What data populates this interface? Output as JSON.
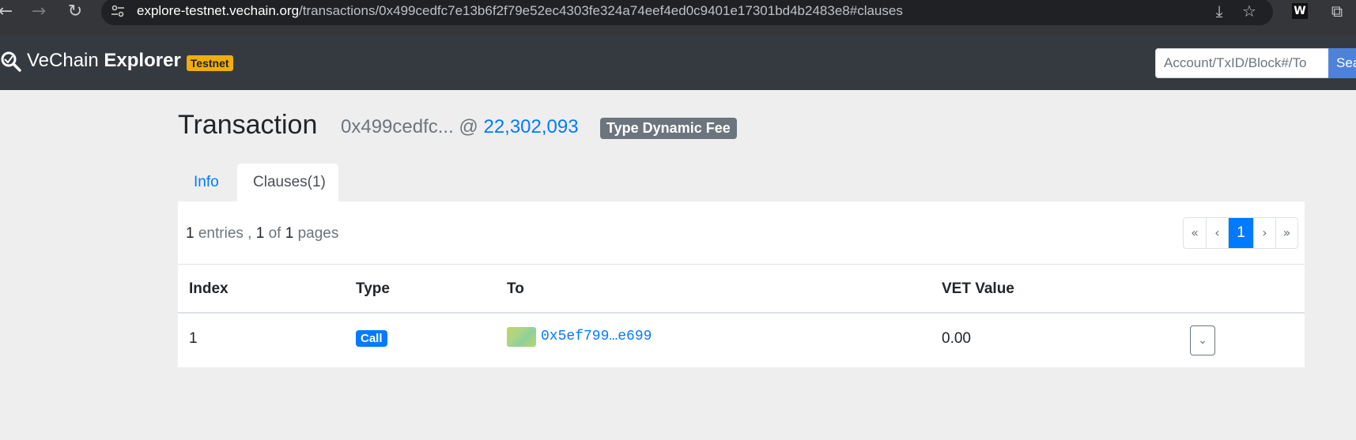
{
  "browser": {
    "url_host": "explore-testnet.vechain.org",
    "url_path": "/transactions/0x499cedfc7e13b6f2f79e52ec4303fe324a74eef4ed0c9401e17301bd4b2483e8#clauses",
    "back_icon": "arrow-left-icon",
    "forward_icon": "arrow-right-icon",
    "reload_icon": "reload-icon",
    "ext_w_label": "W"
  },
  "navbar": {
    "brand_light": "VeChain ",
    "brand_bold": "Explorer",
    "network_badge": "Testnet",
    "search_placeholder": "Account/TxID/Block#/To",
    "search_button": "Sea"
  },
  "header": {
    "title": "Transaction",
    "tx_short": "0x499cedfc...",
    "at": " @ ",
    "block_number": "22,302,093",
    "type_badge": "Type Dynamic Fee"
  },
  "tabs": [
    {
      "label": "Info",
      "active": false
    },
    {
      "label": "Clauses(1)",
      "active": true
    }
  ],
  "summary": {
    "entries": "1",
    "entries_text": " entries , ",
    "page": "1",
    "of_text": " of ",
    "pages": "1",
    "pages_text": " pages"
  },
  "pagination": {
    "first": "«",
    "prev": "‹",
    "current": "1",
    "next": "›",
    "last": "»"
  },
  "table": {
    "columns": [
      "Index",
      "Type",
      "To",
      "VET Value"
    ],
    "rows": [
      {
        "index": "1",
        "type": "Call",
        "to": "0x5ef799…e699",
        "vet_value": "0.00"
      }
    ]
  },
  "colors": {
    "navbar_bg": "#343a40",
    "link_blue": "#007bff",
    "testnet_badge": "#f0ad0c",
    "type_badge": "#6c757d"
  }
}
